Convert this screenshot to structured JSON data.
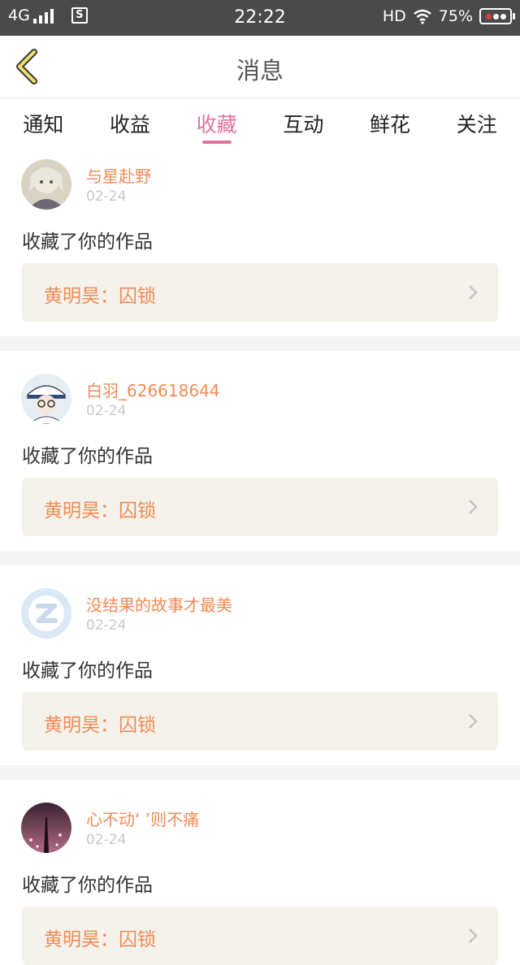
{
  "status_bar": {
    "network": "4G",
    "time": "22:22",
    "hd": "HD",
    "battery": "75%"
  },
  "header": {
    "title": "消息"
  },
  "tabs": [
    {
      "label": "通知",
      "active": false
    },
    {
      "label": "收益",
      "active": false
    },
    {
      "label": "收藏",
      "active": true
    },
    {
      "label": "互动",
      "active": false
    },
    {
      "label": "鲜花",
      "active": false
    },
    {
      "label": "关注",
      "active": false
    }
  ],
  "messages": [
    {
      "username": "与星赴野",
      "date": "02-24",
      "action": "收藏了你的作品",
      "work": "黄明昊：囚锁",
      "avatar": "anime-avatar-white-hair"
    },
    {
      "username": "白羽_626618644",
      "date": "02-24",
      "action": "收藏了你的作品",
      "work": "黄明昊：囚锁",
      "avatar": "anime-avatar-kaito"
    },
    {
      "username": "没结果的故事才最美",
      "date": "02-24",
      "action": "收藏了你的作品",
      "work": "黄明昊：囚锁",
      "avatar": "default-z-avatar"
    },
    {
      "username": "心不动‘ ’则不痛",
      "date": "02-24",
      "action": "收藏了你的作品",
      "work": "黄明昊：囚锁",
      "avatar": "night-city-avatar"
    }
  ],
  "colors": {
    "accent": "#e4709f",
    "username": "#f08b56",
    "work_bg": "#f4f2ea",
    "status_bg": "#4a4a4a"
  }
}
